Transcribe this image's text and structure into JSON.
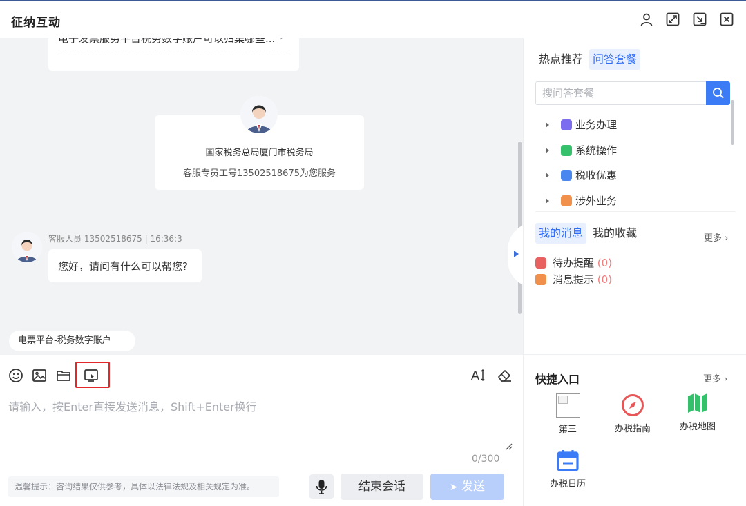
{
  "window": {
    "title": "征纳互动",
    "icons": [
      "user-icon",
      "expand-icon",
      "minimize-to-corner-icon",
      "close-icon"
    ]
  },
  "chat": {
    "faq_item": "电子发票服务平台税务数字账户可以归集哪些...",
    "agent_card": {
      "org": "国家税务总局厦门市税务局",
      "desc": "客服专员工号13502518675为您服务"
    },
    "message": {
      "meta": "客服人员 13502518675 | 16:36:3",
      "text": "您好，请问有什么可以帮您?"
    },
    "quick_tag": "电票平台-税务数字账户"
  },
  "composer": {
    "placeholder": "请输入，按Enter直接发送消息，Shift+Enter换行",
    "counter": "0/300",
    "tip": "温馨提示：咨询结果仅供参考，具体以法律法规及相关规定为准。",
    "end_label": "结束会话",
    "send_label": "发送",
    "font_tool_label": "A"
  },
  "right": {
    "tabs": [
      {
        "label": "热点推荐",
        "active": false
      },
      {
        "label": "问答套餐",
        "active": true
      }
    ],
    "search_placeholder": "搜问答套餐",
    "categories": [
      {
        "label": "业务办理",
        "color": "#7b6cf0"
      },
      {
        "label": "系统操作",
        "color": "#35c06c"
      },
      {
        "label": "税收优惠",
        "color": "#4a86f0"
      },
      {
        "label": "涉外业务",
        "color": "#f0904a"
      }
    ],
    "msg_tabs": [
      {
        "label": "我的消息",
        "active": true
      },
      {
        "label": "我的收藏",
        "active": false
      }
    ],
    "more_label": "更多",
    "messages": [
      {
        "label": "待办提醒",
        "count": "(0)",
        "color": "#e86060"
      },
      {
        "label": "消息提示",
        "count": "(0)",
        "color": "#f0904a"
      }
    ],
    "quick_entry": {
      "title": "快捷入口",
      "more_label": "更多",
      "items": [
        {
          "label": "第三"
        },
        {
          "label": "办税指南",
          "color": "#e85757"
        },
        {
          "label": "办税地图",
          "color": "#35c06c"
        },
        {
          "label": "办税日历",
          "color": "#3b7cf6"
        }
      ]
    }
  }
}
